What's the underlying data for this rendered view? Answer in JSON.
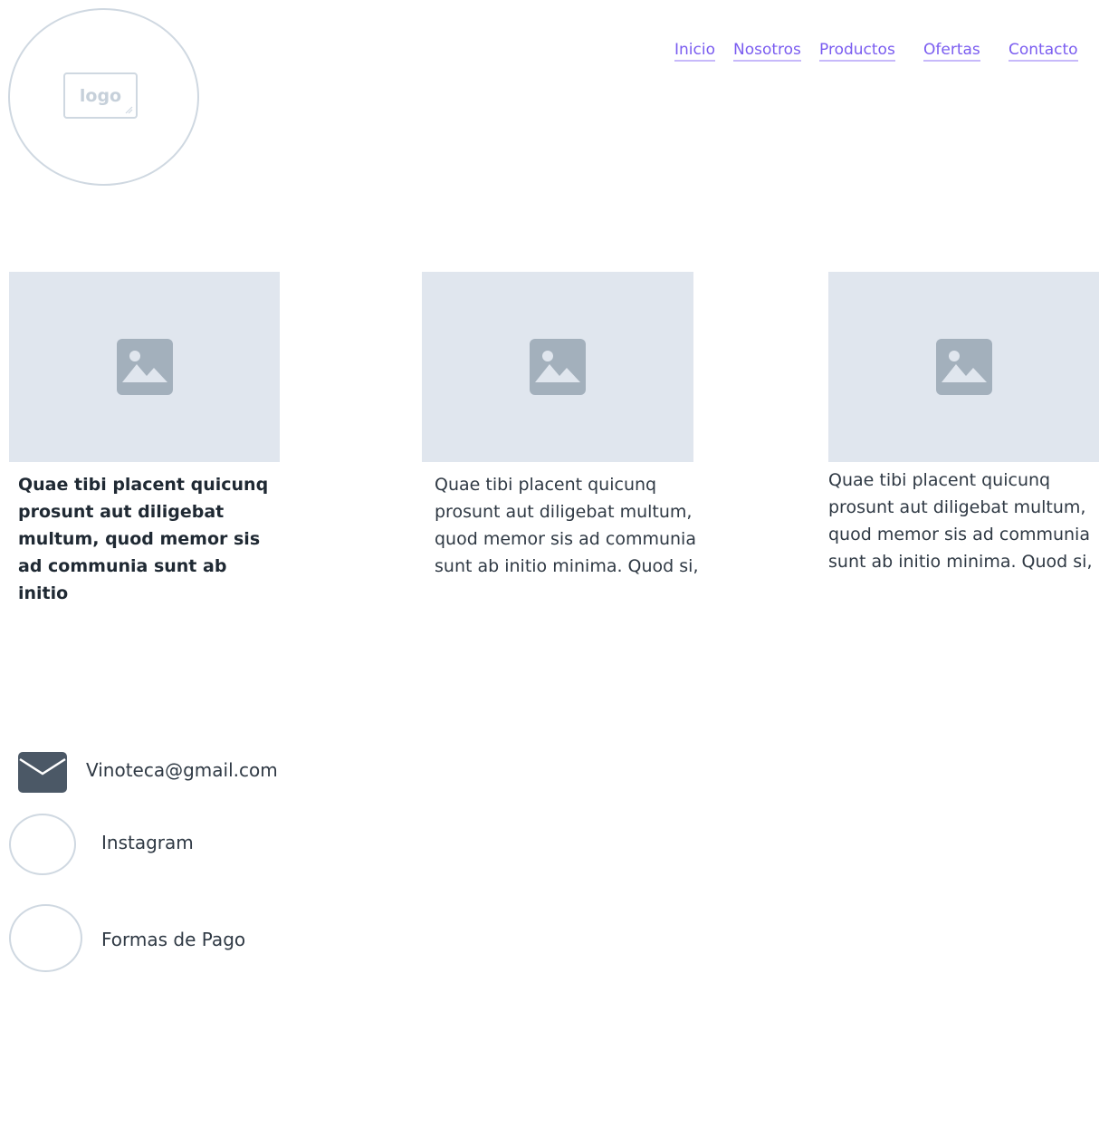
{
  "header": {
    "logo_text": "logo",
    "nav": [
      {
        "label": "Inicio"
      },
      {
        "label": "Nosotros"
      },
      {
        "label": "Productos"
      },
      {
        "label": "Ofertas"
      },
      {
        "label": "Contacto"
      }
    ]
  },
  "cards": [
    {
      "image_icon": "image-placeholder-icon",
      "text": "Quae tibi placent quicunq prosunt aut diligebat multum, quod memor sis ad communia sunt ab initio"
    },
    {
      "image_icon": "image-placeholder-icon",
      "text": "Quae tibi placent quicunq prosunt aut diligebat multum, quod memor sis ad communia sunt ab initio minima. Quod si,"
    },
    {
      "image_icon": "image-placeholder-icon",
      "text": "Quae tibi placent quicunq prosunt aut diligebat multum, quod memor sis ad communia sunt ab initio minima. Quod si,"
    }
  ],
  "contact": {
    "email": "Vinoteca@gmail.com",
    "instagram": "Instagram",
    "payment": "Formas de Pago"
  },
  "colors": {
    "link": "#7a5cf0",
    "placeholder_bg": "#e0e6ee",
    "placeholder_icon": "#a3b0bc",
    "outline": "#cfd8e1",
    "mail_icon": "#4b5866"
  }
}
